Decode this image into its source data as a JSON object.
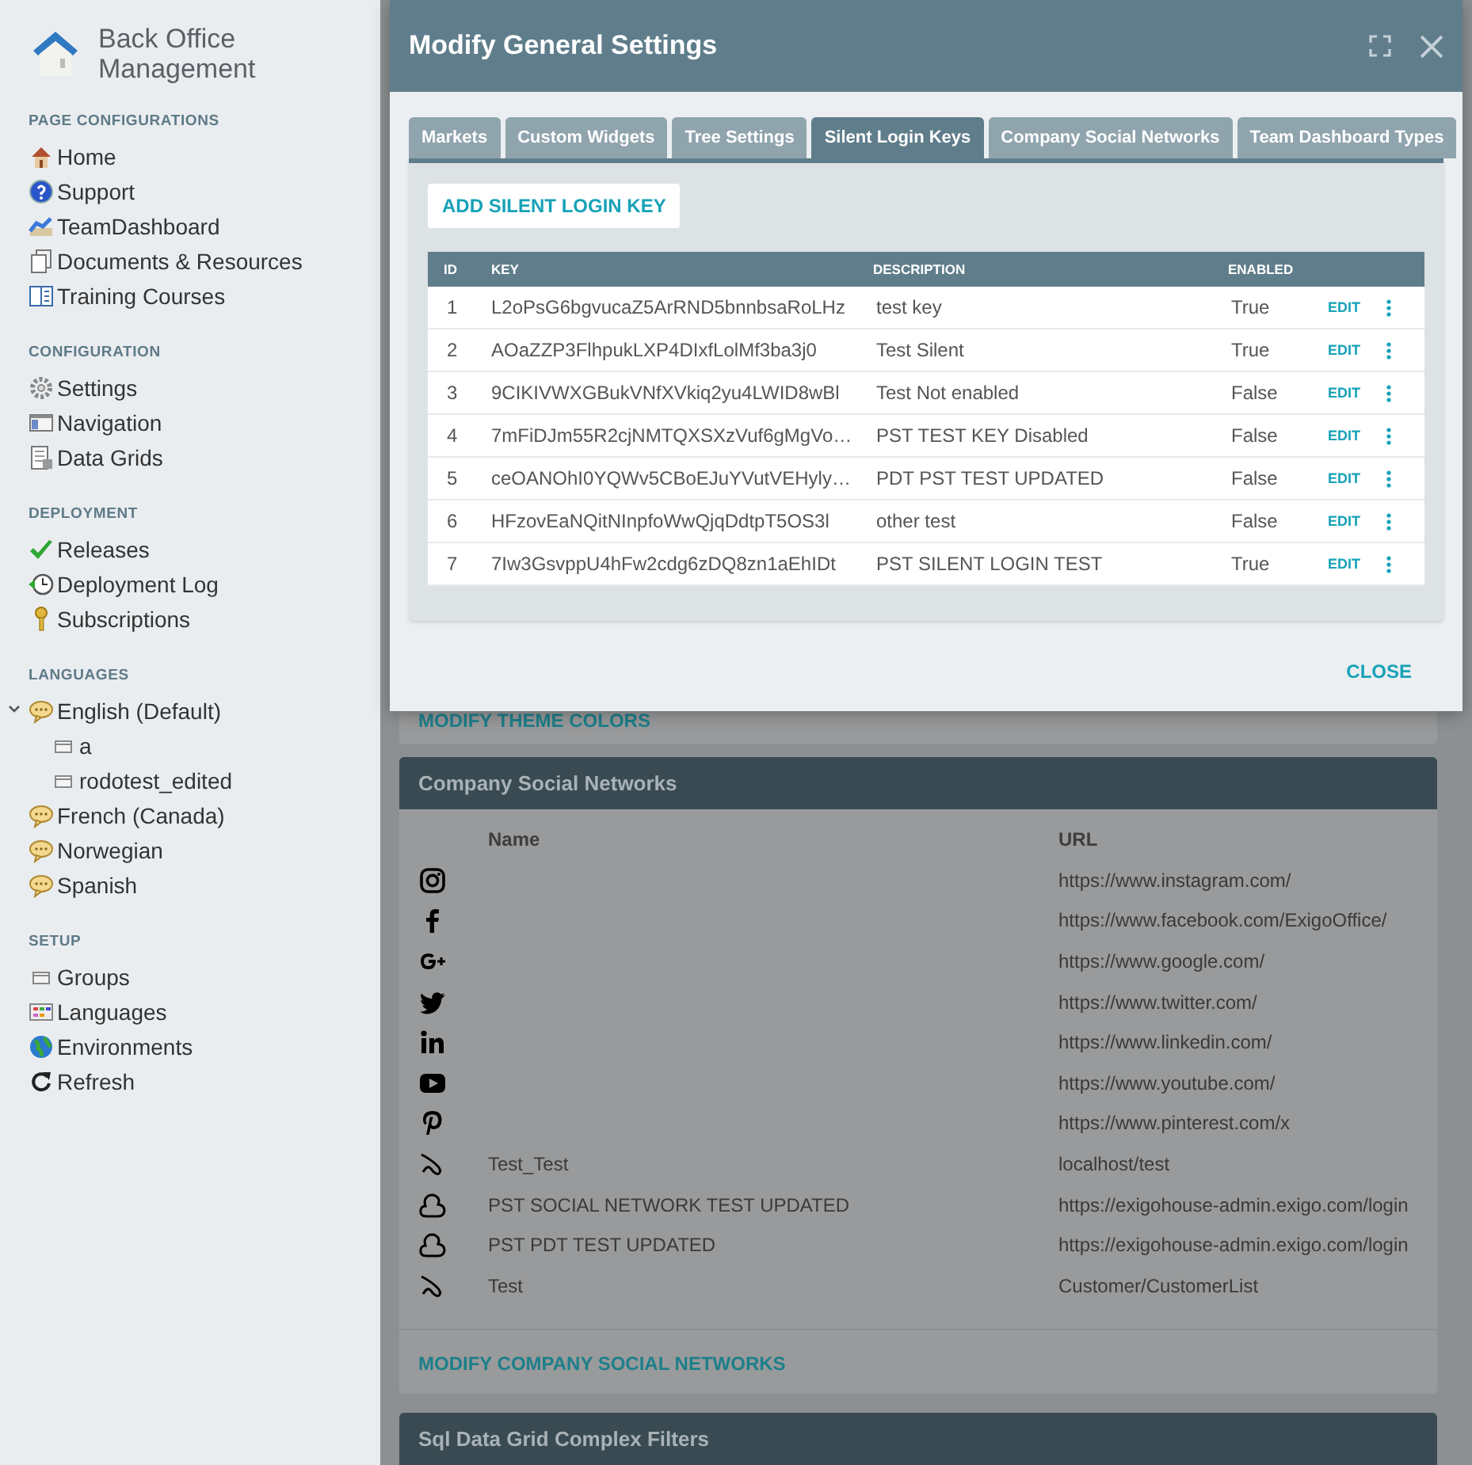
{
  "sidebar": {
    "app_title": "Back Office Management",
    "sections": [
      {
        "title": "PAGE CONFIGURATIONS",
        "items": [
          {
            "label": "Home",
            "kind": "home"
          },
          {
            "label": "Support",
            "kind": "help"
          },
          {
            "label": "TeamDashboard",
            "kind": "chart"
          },
          {
            "label": "Documents & Resources",
            "kind": "documents"
          },
          {
            "label": "Training Courses",
            "kind": "book"
          }
        ]
      },
      {
        "title": "CONFIGURATION",
        "items": [
          {
            "label": "Settings",
            "kind": "gear"
          },
          {
            "label": "Navigation",
            "kind": "window"
          },
          {
            "label": "Data Grids",
            "kind": "grid"
          }
        ]
      },
      {
        "title": "DEPLOYMENT",
        "items": [
          {
            "label": "Releases",
            "kind": "check"
          },
          {
            "label": "Deployment Log",
            "kind": "clock"
          },
          {
            "label": "Subscriptions",
            "kind": "key"
          }
        ]
      },
      {
        "title": "LANGUAGES",
        "items": [
          {
            "label": "English (Default)",
            "kind": "speech",
            "expanded": true,
            "children": [
              {
                "label": "a",
                "kind": "folder"
              },
              {
                "label": "rodotest_edited",
                "kind": "folder"
              }
            ]
          },
          {
            "label": "French (Canada)",
            "kind": "speech"
          },
          {
            "label": "Norwegian",
            "kind": "speech"
          },
          {
            "label": "Spanish",
            "kind": "speech"
          }
        ]
      },
      {
        "title": "SETUP",
        "items": [
          {
            "label": "Groups",
            "kind": "folder"
          },
          {
            "label": "Languages",
            "kind": "table"
          },
          {
            "label": "Environments",
            "kind": "globe"
          },
          {
            "label": "Refresh",
            "kind": "refresh"
          }
        ]
      }
    ]
  },
  "page": {
    "theme_link": "MODIFY THEME COLORS",
    "social_card": {
      "title": "Company Social Networks",
      "columns": [
        "Name",
        "URL"
      ],
      "rows": [
        {
          "kind": "instagram",
          "name": "",
          "url": "https://www.instagram.com/"
        },
        {
          "kind": "facebook",
          "name": "",
          "url": "https://www.facebook.com/ExigoOffice/"
        },
        {
          "kind": "googleplus",
          "name": "",
          "url": "https://www.google.com/"
        },
        {
          "kind": "twitter",
          "name": "",
          "url": "https://www.twitter.com/"
        },
        {
          "kind": "linkedin",
          "name": "",
          "url": "https://www.linkedin.com/"
        },
        {
          "kind": "youtube",
          "name": "",
          "url": "https://www.youtube.com/"
        },
        {
          "kind": "pinterest",
          "name": "",
          "url": "https://www.pinterest.com/x"
        },
        {
          "kind": "custom",
          "name": "Test_Test",
          "url": "localhost/test"
        },
        {
          "kind": "cloud",
          "name": "PST SOCIAL NETWORK TEST UPDATED",
          "url": "https://exigohouse-admin.exigo.com/login"
        },
        {
          "kind": "cloud",
          "name": "PST PDT TEST UPDATED",
          "url": "https://exigohouse-admin.exigo.com/login"
        },
        {
          "kind": "custom",
          "name": "Test",
          "url": "Customer/CustomerList"
        }
      ],
      "footer_link": "MODIFY COMPANY SOCIAL NETWORKS"
    },
    "next_card": {
      "title": "Sql Data Grid Complex Filters"
    }
  },
  "dialog": {
    "title": "Modify General Settings",
    "tabs": [
      {
        "label": "Markets",
        "selected": false
      },
      {
        "label": "Custom Widgets",
        "selected": false
      },
      {
        "label": "Tree Settings",
        "selected": false
      },
      {
        "label": "Silent Login Keys",
        "selected": true
      },
      {
        "label": "Company Social Networks",
        "selected": false
      },
      {
        "label": "Team Dashboard Types",
        "selected": false
      }
    ],
    "add_button": "ADD SILENT LOGIN KEY",
    "table": {
      "columns": [
        "ID",
        "KEY",
        "DESCRIPTION",
        "ENABLED"
      ],
      "rows": [
        {
          "id": "1",
          "key": "L2oPsG6bgvucaZ5ArRND5bnnbsaRoLHz",
          "description": "test key",
          "enabled": "True",
          "action": "EDIT"
        },
        {
          "id": "2",
          "key": "AOaZZP3FlhpukLXP4DIxfLolMf3ba3j0",
          "description": "Test Silent",
          "enabled": "True",
          "action": "EDIT"
        },
        {
          "id": "3",
          "key": "9CIKIVWXGBukVNfXVkiq2yu4LWID8wBl",
          "description": "Test Not enabled",
          "enabled": "False",
          "action": "EDIT"
        },
        {
          "id": "4",
          "key": "7mFiDJm55R2cjNMTQXSXzVuf6gMgVo…",
          "description": "PST TEST KEY Disabled",
          "enabled": "False",
          "action": "EDIT"
        },
        {
          "id": "5",
          "key": "ceOANOhI0YQWv5CBoEJuYVutVEHyly…",
          "description": "PDT PST TEST UPDATED",
          "enabled": "False",
          "action": "EDIT"
        },
        {
          "id": "6",
          "key": "HFzovEaNQitNInpfoWwQjqDdtpT5OS3l",
          "description": "other test",
          "enabled": "False",
          "action": "EDIT"
        },
        {
          "id": "7",
          "key": "7Iw3GsvppU4hFw2cdg6zDQ8zn1aEhIDt",
          "description": "PST SILENT LOGIN TEST",
          "enabled": "True",
          "action": "EDIT"
        }
      ]
    },
    "close_button": "CLOSE"
  }
}
